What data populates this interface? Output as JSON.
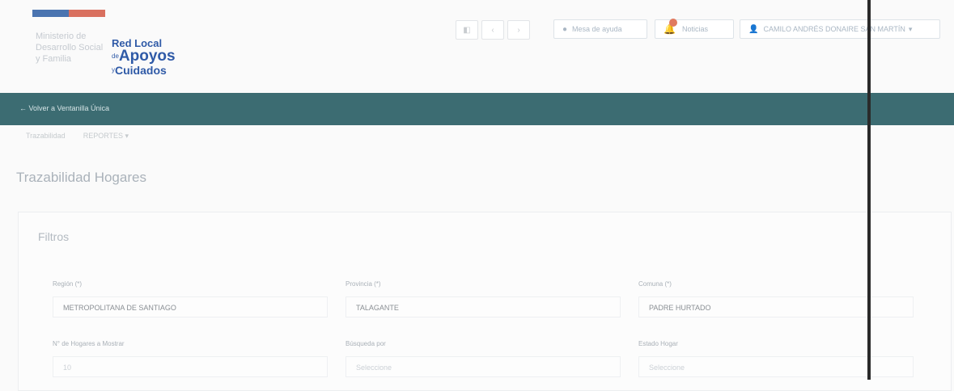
{
  "header": {
    "ministry": "Ministerio de Desarrollo Social y Familia",
    "brand_line1": "Red Local",
    "brand_de": "de",
    "brand_line2": "Apoyos",
    "brand_y": "y",
    "brand_line3": "Cuidados",
    "help_label": "Mesa de ayuda",
    "notifications_label": "Noticias",
    "notifications_count": "",
    "user_label": "CAMILO ANDRÉS DONAIRE SAN MARTÍN"
  },
  "nav": {
    "back_label": "← Volver a Ventanilla Única",
    "tabs": [
      "Trazabilidad",
      "REPORTES ▾"
    ]
  },
  "page": {
    "title": "Trazabilidad Hogares"
  },
  "filters": {
    "title": "Filtros",
    "region": {
      "label": "Región (*)",
      "value": "METROPOLITANA DE SANTIAGO"
    },
    "provincia": {
      "label": "Provincia (*)",
      "value": "TALAGANTE"
    },
    "comuna": {
      "label": "Comuna (*)",
      "value": "PADRE HURTADO"
    },
    "n_hogares": {
      "label": "N° de Hogares a Mostrar",
      "value": "10"
    },
    "busqueda": {
      "label": "Búsqueda por",
      "value": "Seleccione"
    },
    "estado": {
      "label": "Estado Hogar",
      "value": "Seleccione"
    }
  },
  "colors": {
    "teal_bar": "#3c6c72",
    "brand_blue": "#2f5aa7"
  }
}
